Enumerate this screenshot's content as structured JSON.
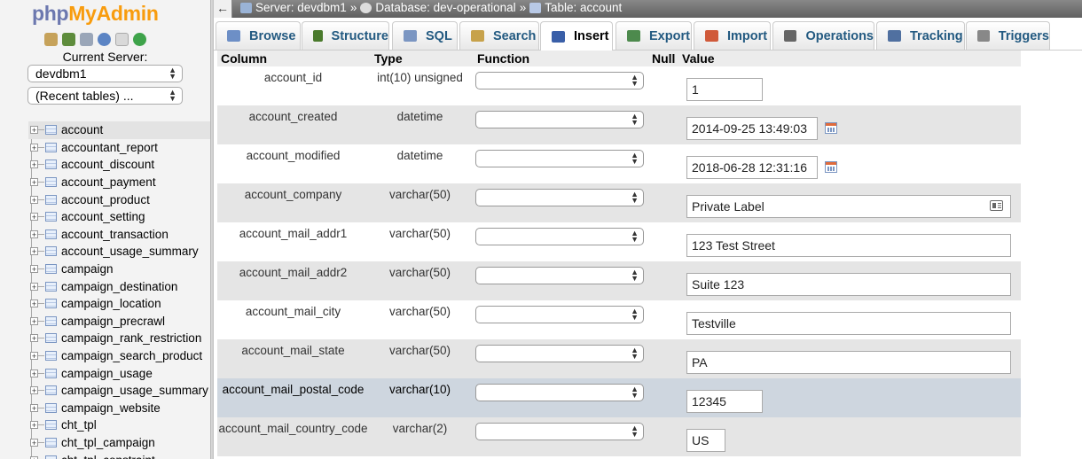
{
  "app": {
    "logo_php": "php",
    "logo_myadmin": "MyAdmin"
  },
  "sidebar": {
    "current_server_label": "Current Server:",
    "server_select": "devdbm1",
    "recent_select": "(Recent tables) ...",
    "quick_icons": [
      "home-icon",
      "exit-icon",
      "query-window-icon",
      "documentation-icon",
      "copy-icon",
      "reload-icon"
    ],
    "tables": [
      "account",
      "accountant_report",
      "account_discount",
      "account_payment",
      "account_product",
      "account_setting",
      "account_transaction",
      "account_usage_summary",
      "campaign",
      "campaign_destination",
      "campaign_location",
      "campaign_precrawl",
      "campaign_rank_restriction",
      "campaign_search_product",
      "campaign_usage",
      "campaign_usage_summary",
      "campaign_website",
      "cht_tpl",
      "cht_tpl_campaign",
      "cht_tpl_constraint"
    ]
  },
  "breadcrumb": {
    "server": "Server: devdbm1",
    "sep1": "»",
    "database": "Database: dev-operational",
    "sep2": "»",
    "table": "Table: account"
  },
  "tabs": [
    {
      "label": "Browse",
      "icon": "browse-icon"
    },
    {
      "label": "Structure",
      "icon": "structure-icon"
    },
    {
      "label": "SQL",
      "icon": "sql-icon"
    },
    {
      "label": "Search",
      "icon": "search-icon"
    },
    {
      "label": "Insert",
      "icon": "insert-icon",
      "active": true
    },
    {
      "label": "Export",
      "icon": "export-icon"
    },
    {
      "label": "Import",
      "icon": "import-icon"
    },
    {
      "label": "Operations",
      "icon": "operations-icon"
    },
    {
      "label": "Tracking",
      "icon": "tracking-icon"
    },
    {
      "label": "Triggers",
      "icon": "triggers-icon"
    }
  ],
  "grid": {
    "headers": {
      "column": "Column",
      "type": "Type",
      "function": "Function",
      "null": "Null",
      "value": "Value"
    },
    "rows": [
      {
        "column": "account_id",
        "type": "int(10) unsigned",
        "value": "1"
      },
      {
        "column": "account_created",
        "type": "datetime",
        "value": "2014-09-25 13:49:03"
      },
      {
        "column": "account_modified",
        "type": "datetime",
        "value": "2018-06-28 12:31:16"
      },
      {
        "column": "account_company",
        "type": "varchar(50)",
        "value": "Private Label"
      },
      {
        "column": "account_mail_addr1",
        "type": "varchar(50)",
        "value": "123 Test Street"
      },
      {
        "column": "account_mail_addr2",
        "type": "varchar(50)",
        "value": "Suite 123"
      },
      {
        "column": "account_mail_city",
        "type": "varchar(50)",
        "value": "Testville"
      },
      {
        "column": "account_mail_state",
        "type": "varchar(50)",
        "value": "PA"
      },
      {
        "column": "account_mail_postal_code",
        "type": "varchar(10)",
        "value": "12345"
      },
      {
        "column": "account_mail_country_code",
        "type": "varchar(2)",
        "value": "US"
      }
    ]
  }
}
